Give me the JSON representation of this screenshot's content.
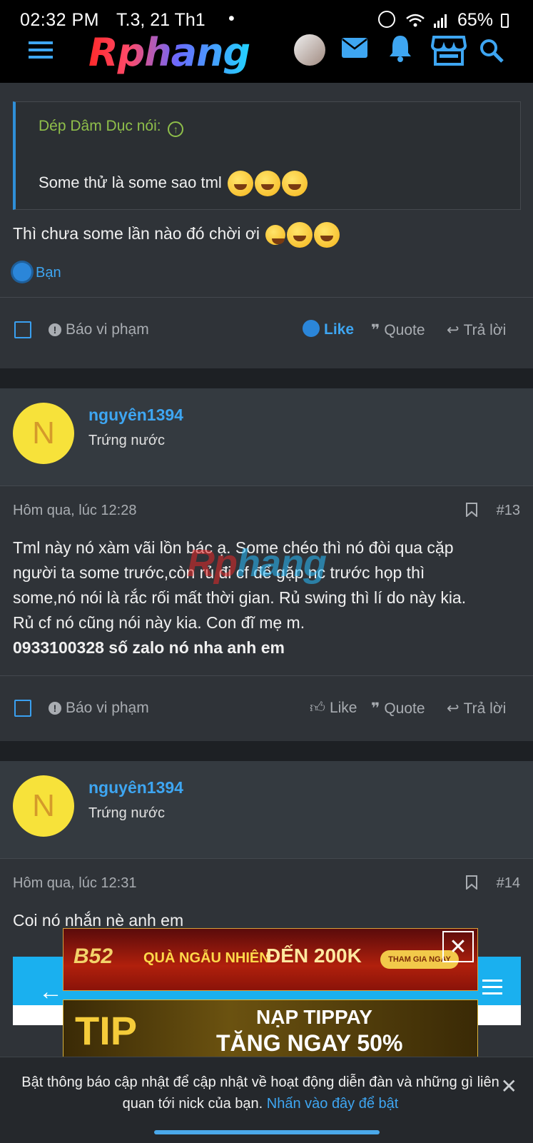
{
  "status": {
    "time": "02:32 PM",
    "date": "T.3, 21 Th1",
    "dot": "•",
    "battery": "65%"
  },
  "header": {
    "logo": "Rphang"
  },
  "post12": {
    "quote_author": "Dép Dâm Dục nói:",
    "quote_text": "Some thử là some sao tml",
    "text": "Thì chưa some lần nào đó chời ơi",
    "reaction_label": "Bạn",
    "actions": {
      "report": "Báo vi phạm",
      "like": "Like",
      "quote": "Quote",
      "reply": "Trả lời"
    }
  },
  "post13": {
    "avatar_letter": "N",
    "username": "nguyên1394",
    "user_title": "Trứng nước",
    "timestamp": "Hôm qua, lúc 12:28",
    "number": "#13",
    "lines": [
      "Tml này nó xàm vãi lồn bác ạ. Some chéo thì nó đòi qua cặp",
      "người ta some trước,còn rủ đi cf để gặp nc trước họp thì",
      "some,nó nói là rắc rối mất thời gian. Rủ swing thì lí do này kia.",
      "Rủ cf nó cũng nói này kia. Con đĩ mẹ m."
    ],
    "bold_line": "0933100328 số zalo nó nha anh em",
    "actions": {
      "report": "Báo vi phạm",
      "like": "Like",
      "quote": "Quote",
      "reply": "Trả lời"
    }
  },
  "post14": {
    "avatar_letter": "N",
    "username": "nguyên1394",
    "user_title": "Trứng nước",
    "timestamp": "Hôm qua, lúc 12:31",
    "number": "#14",
    "text": "Coi nó nhắn nè anh em"
  },
  "watermark": {
    "part1": "Rp",
    "part2": "hang"
  },
  "ads": {
    "ad1_brand": "B52",
    "ad1_text": "QUÀ NGẪU NHIÊN",
    "ad1_amount": "ĐẾN 200K",
    "ad1_badge": "THAM GIA NGAY",
    "ad2_brand": "TIP",
    "ad2_line1": "NẠP TIPPAY",
    "ad2_line2": "TĂNG NGAY 50%",
    "close": "✕"
  },
  "notification": {
    "text": "Bật thông báo cập nhật để cập nhật về hoạt động diễn đàn và những gì liên quan tới nick của bạn.",
    "link": "Nhấn vào đây để bật",
    "close": "✕"
  },
  "colors": {
    "accent": "#3ea6f2",
    "quote_author": "#8fbf4a",
    "avatar": "#f7e23a"
  }
}
